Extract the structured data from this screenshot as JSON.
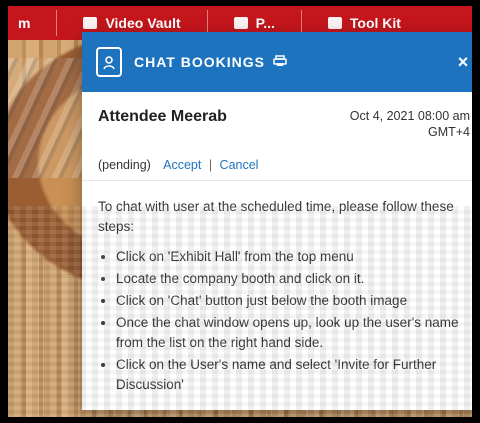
{
  "top_nav": {
    "items": [
      {
        "label": "m"
      },
      {
        "label": "Video Vault"
      },
      {
        "label": "P..."
      },
      {
        "label": "Tool Kit"
      }
    ]
  },
  "modal": {
    "title": "CHAT BOOKINGS",
    "close_glyph": "×",
    "print_icon_name": "print-icon",
    "header_icon_name": "contact-book-icon",
    "attendee_name": "Attendee Meerab",
    "datetime": "Oct 4, 2021 08:00 am",
    "timezone": "GMT+4",
    "status": "(pending)",
    "actions": {
      "accept": "Accept",
      "separator": "|",
      "cancel": "Cancel"
    },
    "instructions_intro": "To chat with user at the scheduled time, please follow these steps:",
    "steps": [
      "Click on 'Exhibit Hall' from the top menu",
      "Locate the company booth and click on it.",
      "Click on 'Chat' button just below the booth image",
      "Once the chat window opens up, look up the user's name from the list on the right hand side.",
      "Click on the User's name and select 'Invite for Further Discussion'"
    ]
  },
  "colors": {
    "top_nav_bg": "#c4161c",
    "modal_header_bg": "#1e73be",
    "link": "#1e73be"
  }
}
